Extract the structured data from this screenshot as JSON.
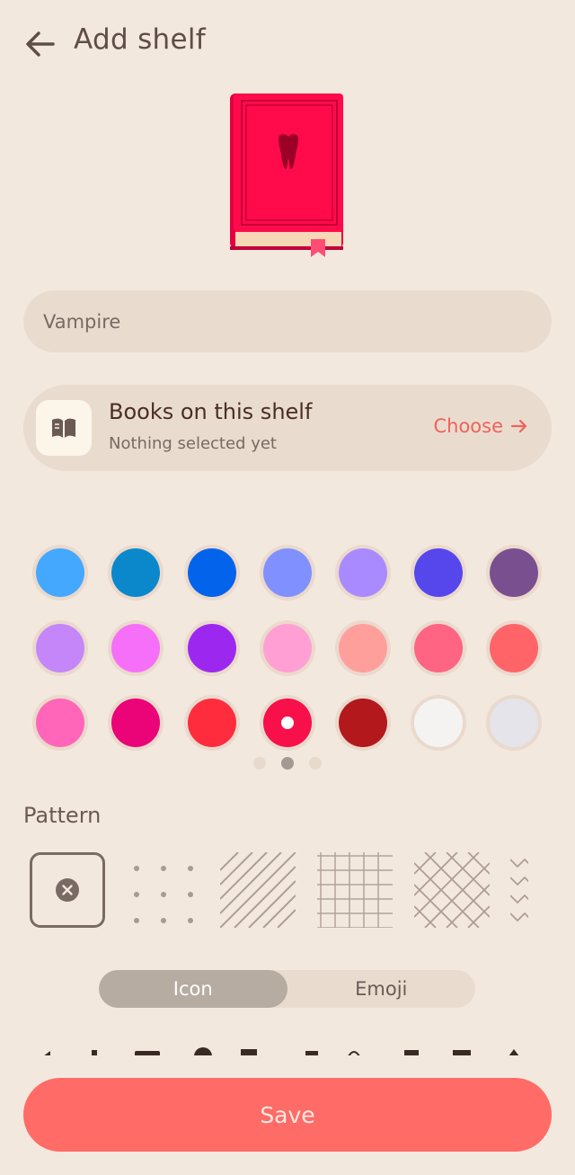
{
  "header": {
    "title": "Add shelf"
  },
  "name_field": {
    "value": "Vampire"
  },
  "books_card": {
    "title": "Books on this shelf",
    "subtitle": "Nothing selected yet",
    "choose_label": "Choose"
  },
  "colors": {
    "rows": [
      [
        "#45a8ff",
        "#0b88cc",
        "#0363eb",
        "#8090ff",
        "#a98bff",
        "#5547ec",
        "#7a4f90"
      ],
      [
        "#c486f8",
        "#f66ff8",
        "#9c28f0",
        "#ff9fd3",
        "#ff9f9b",
        "#ff6482",
        "#ff6468"
      ],
      [
        "#ff66b9",
        "#ea0477",
        "#ff2c3e",
        "#f7104a",
        "#b3181d",
        "#f5f3f2",
        "#e4e4ea"
      ]
    ],
    "selected_index": 17,
    "page_count": 3,
    "current_page": 1
  },
  "pattern": {
    "label": "Pattern",
    "options": [
      "none",
      "dots",
      "diagonal-lines",
      "grid",
      "crosshatch",
      "zigzag"
    ],
    "selected": "none"
  },
  "segmented": {
    "icon_label": "Icon",
    "emoji_label": "Emoji",
    "active": "icon"
  },
  "book_preview": {
    "cover_color": "#ff0b4c",
    "icon": "tooth-icon"
  },
  "save_label": "Save"
}
